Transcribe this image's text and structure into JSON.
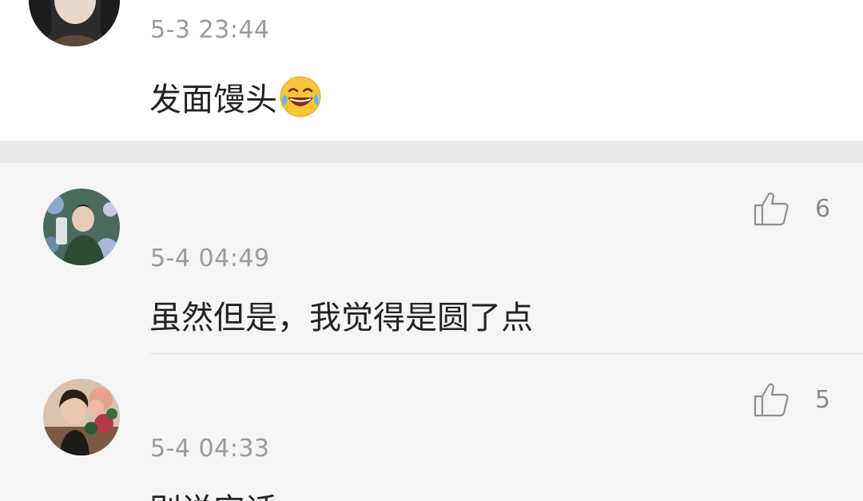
{
  "main_comment": {
    "timestamp": "5-3 23:44",
    "text": "发面馒头",
    "emoji_icon": "laughing-tears-emoji"
  },
  "replies": [
    {
      "timestamp": "5-4 04:49",
      "text": "虽然但是，我觉得是圆了点",
      "likes": "6",
      "like_icon": "thumbs-up-icon"
    },
    {
      "timestamp": "5-4 04:33",
      "text": "别说实话",
      "likes": "5",
      "like_icon": "thumbs-up-icon"
    }
  ],
  "colors": {
    "background_top": "#ffffff",
    "background_replies": "#f5f5f5",
    "divider": "#e9e9e9",
    "timestamp": "#9b9b9b",
    "text": "#222222"
  }
}
